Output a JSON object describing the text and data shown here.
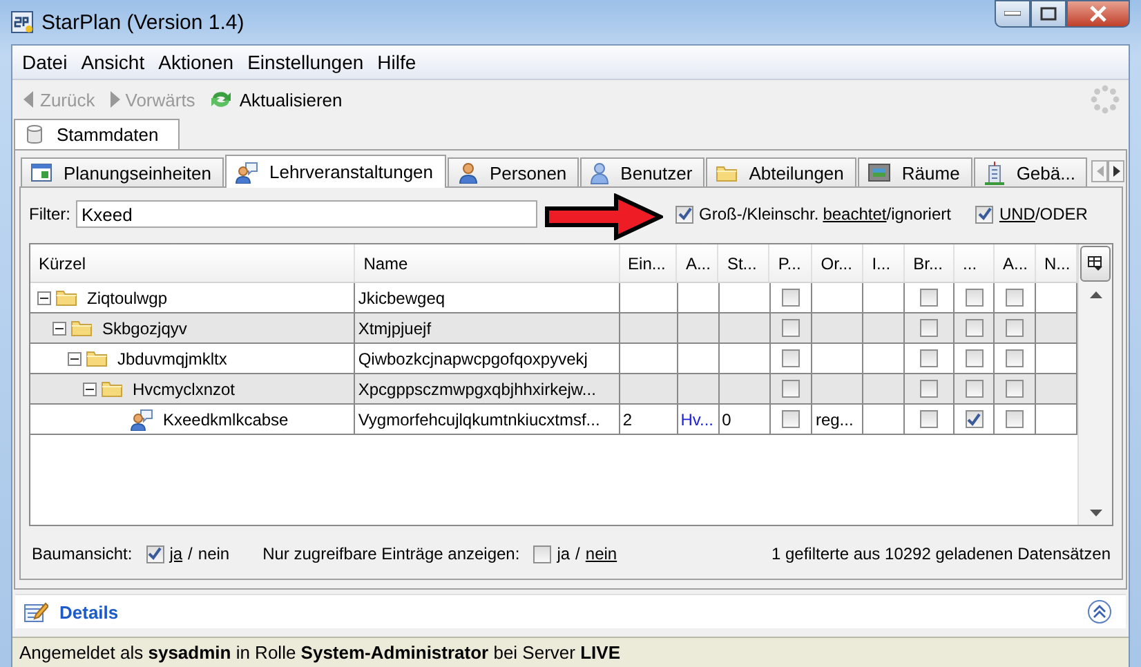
{
  "window": {
    "title": "StarPlan (Version 1.4)"
  },
  "menu": [
    "Datei",
    "Ansicht",
    "Aktionen",
    "Einstellungen",
    "Hilfe"
  ],
  "toolbar": [
    {
      "label": "Zurück",
      "kind": "back",
      "disabled": true
    },
    {
      "label": "Vorwärts",
      "kind": "forward",
      "disabled": true
    },
    {
      "label": "Aktualisieren",
      "kind": "refresh",
      "disabled": false
    }
  ],
  "outer_tabs": [
    {
      "label": "Stammdaten",
      "kind": "database",
      "selected": true
    }
  ],
  "tabs": [
    {
      "label": "Planungseinheiten",
      "kind": "table",
      "selected": false
    },
    {
      "label": "Lehrveranstaltungen",
      "kind": "course",
      "selected": true
    },
    {
      "label": "Personen",
      "kind": "person",
      "selected": false
    },
    {
      "label": "Benutzer",
      "kind": "user",
      "selected": false
    },
    {
      "label": "Abteilungen",
      "kind": "folder",
      "selected": false
    },
    {
      "label": "Räume",
      "kind": "room",
      "selected": false
    },
    {
      "label": "Gebä...",
      "kind": "building",
      "selected": false
    }
  ],
  "filter": {
    "label": "Filter:",
    "value": "Kxeed",
    "case_option": {
      "checked": true,
      "label": "Groß-/Kleinschr.",
      "separator": "/",
      "options": [
        {
          "label": "beachtet",
          "selected": true
        },
        {
          "label": "ignoriert",
          "selected": false
        }
      ]
    },
    "logic_option": {
      "checked": true,
      "separator": "/",
      "options": [
        {
          "label": "UND",
          "selected": true
        },
        {
          "label": "ODER",
          "selected": false
        }
      ]
    }
  },
  "table": {
    "columns": [
      {
        "label": "Kürzel",
        "kind": "tree"
      },
      {
        "label": "Name",
        "kind": "text"
      },
      {
        "label": "Ein...",
        "kind": "text"
      },
      {
        "label": "A...",
        "kind": "link"
      },
      {
        "label": "St...",
        "kind": "text"
      },
      {
        "label": "P...",
        "kind": "check"
      },
      {
        "label": "Or...",
        "kind": "text"
      },
      {
        "label": "I...",
        "kind": "text"
      },
      {
        "label": "Br...",
        "kind": "check"
      },
      {
        "label": "...",
        "kind": "check"
      },
      {
        "label": "A...",
        "kind": "check"
      },
      {
        "label": "N...",
        "kind": "text"
      }
    ],
    "rows": [
      {
        "kind": "folder",
        "expanded": true,
        "cells": [
          "Ziqtoulwgp",
          "Jkicbewgeq",
          null,
          null,
          null,
          {
            "checked": false
          },
          null,
          null,
          {
            "checked": false
          },
          {
            "checked": false
          },
          {
            "checked": false
          },
          null
        ],
        "children": [
          {
            "kind": "folder",
            "expanded": true,
            "cells": [
              "Skbgozjqyv",
              "Xtmjpjuejf",
              null,
              null,
              null,
              {
                "checked": false
              },
              null,
              null,
              {
                "checked": false
              },
              {
                "checked": false
              },
              {
                "checked": false
              },
              null
            ],
            "children": [
              {
                "kind": "folder",
                "expanded": true,
                "cells": [
                  "Jbduvmqjmkltx",
                  "Qiwbozkcjnapwcpgofqoxpyvekj",
                  null,
                  null,
                  null,
                  {
                    "checked": false
                  },
                  null,
                  null,
                  {
                    "checked": false
                  },
                  {
                    "checked": false
                  },
                  {
                    "checked": false
                  },
                  null
                ],
                "children": [
                  {
                    "kind": "folder",
                    "expanded": true,
                    "cells": [
                      "Hvcmyclxnzot",
                      "Xpcgppsczmwpgxqbjhhxirkejw...",
                      null,
                      null,
                      null,
                      {
                        "checked": false
                      },
                      null,
                      null,
                      {
                        "checked": false
                      },
                      {
                        "checked": false
                      },
                      {
                        "checked": false
                      },
                      null
                    ],
                    "children": [
                      {
                        "kind": "course",
                        "cells": [
                          "Kxeedkmlkcabse",
                          "Vygmorfehcujlqkumtnkiucxtmsf...",
                          "2",
                          "Hv...",
                          "0",
                          {
                            "checked": false
                          },
                          "reg...",
                          null,
                          {
                            "checked": false
                          },
                          {
                            "checked": true
                          },
                          {
                            "checked": false
                          },
                          null
                        ]
                      }
                    ]
                  }
                ]
              }
            ]
          }
        ]
      }
    ]
  },
  "tree_view": {
    "label": "Baumansicht:",
    "checked": true,
    "separator": "/",
    "options": [
      {
        "label": "ja",
        "selected": true
      },
      {
        "label": "nein",
        "selected": false
      }
    ]
  },
  "accessible_only": {
    "label": "Nur zugreifbare Einträge anzeigen:",
    "checked": false,
    "separator": "/",
    "options": [
      {
        "label": "ja",
        "selected": false
      },
      {
        "label": "nein",
        "selected": true
      }
    ]
  },
  "record_count": "1 gefilterte aus 10292 geladenen Datensätzen",
  "details": {
    "label": "Details",
    "expanded": false
  },
  "status_bar": "Angemeldet als **sysadmin** in Rolle **System-Administrator** bei Server **LIVE**"
}
